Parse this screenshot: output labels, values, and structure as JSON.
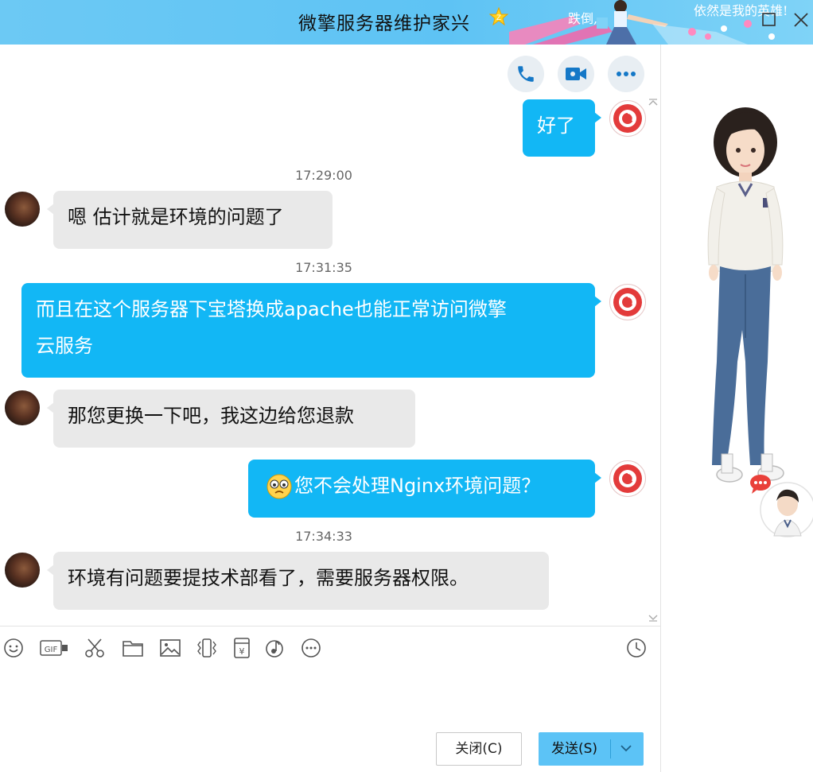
{
  "window": {
    "title": "微擎服务器维护家兴",
    "banner_text_1": "跌倒,",
    "banner_text_2": "依然是我的英雄!"
  },
  "messages": [
    {
      "sender": "me",
      "text": "好了"
    },
    {
      "time": "17:29:00"
    },
    {
      "sender": "other",
      "text": "嗯 估计就是环境的问题了"
    },
    {
      "time": "17:31:35"
    },
    {
      "sender": "me",
      "text_line1": "而且在这个服务器下宝塔换成apache也能正常访问微擎",
      "text_line2": "云服务"
    },
    {
      "sender": "other",
      "text": "那您更换一下吧，我这边给您退款"
    },
    {
      "sender": "me",
      "text": "您不会处理Nginx环境问题？"
    },
    {
      "time": "17:34:33"
    },
    {
      "sender": "other",
      "text": "环境有问题要提技术部看了，需要服务器权限。"
    }
  ],
  "toolbar": {
    "icons": [
      "emoji-icon",
      "gif-icon",
      "scissors-icon",
      "folder-icon",
      "image-icon",
      "shake-icon",
      "red-packet-icon",
      "music-icon",
      "more-icon"
    ],
    "history_icon": "clock-icon"
  },
  "buttons": {
    "close_label": "关闭(C)",
    "send_label": "发送(S)"
  },
  "colors": {
    "accent": "#12b7f5",
    "titlebar": "#5ec3f4",
    "other_bubble": "#e9e9e9"
  }
}
